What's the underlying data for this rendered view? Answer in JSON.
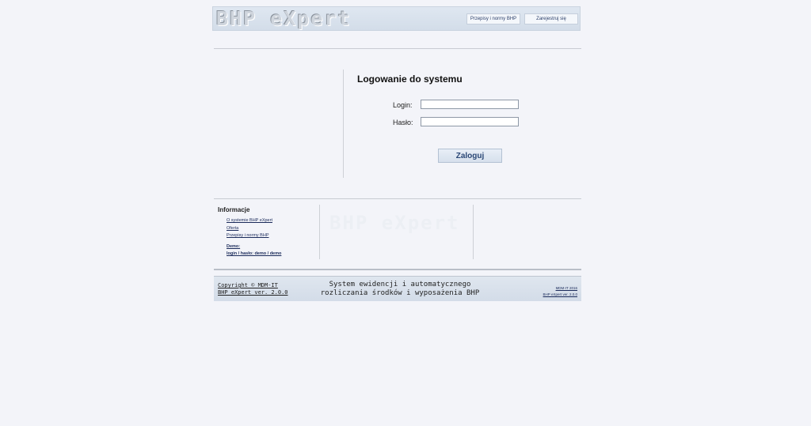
{
  "header": {
    "logo_text": "BHP eXpert",
    "nav": [
      {
        "label": "Przepisy i normy BHP"
      },
      {
        "label": "Zarejestruj się"
      }
    ]
  },
  "login": {
    "title": "Logowanie do systemu",
    "login_label": "Login:",
    "login_value": "",
    "password_label": "Hasło:",
    "password_value": "",
    "submit_label": "Zaloguj"
  },
  "info": {
    "heading": "Informacje",
    "links": [
      "O systemie BHP eXpert",
      "Oferta",
      "Przepisy i normy BHP"
    ],
    "demo_label": "Demo:",
    "demo_credentials": "login / hasło:   demo / demo",
    "watermark": "BHP eXpert"
  },
  "footer": {
    "copyright": "Copyright © MDM-IT",
    "version": "BHP eXpert ver. 2.0.0",
    "description_line1": "System ewidencji i automatycznego",
    "description_line2": "rozliczania środków i wyposażenia BHP",
    "right_line1": "MDM-IT 2016",
    "right_line2": "BHP eXpert ver. 2.0.0"
  }
}
